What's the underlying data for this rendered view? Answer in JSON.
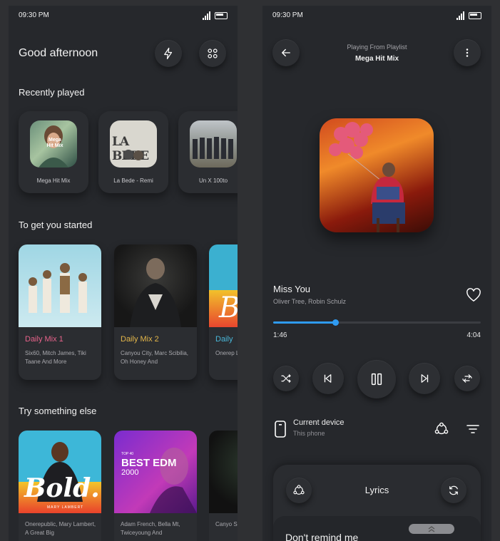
{
  "left": {
    "status": {
      "time": "09:30 PM",
      "network": "5G"
    },
    "greeting": "Good afternoon",
    "sections": {
      "recently_played": "Recently played",
      "to_get_started": "To get you started",
      "try_something": "Try something else"
    },
    "recent": [
      {
        "label": "Mega Hit Mix",
        "art_text": "Mega Hit Mix"
      },
      {
        "label": "La Bede - Remi",
        "art_text": "LA BEDE"
      },
      {
        "label": "Un X 100to"
      }
    ],
    "mixes": [
      {
        "name": "Daily Mix 1",
        "desc": "Six60, Mitch James, Tiki Taane And More",
        "color": "#e7638b"
      },
      {
        "name": "Daily Mix 2",
        "desc": "Canyou City, Marc Scibilia, Oh Honey And",
        "color": "#e3b64a"
      },
      {
        "name": "Daily",
        "desc": "Onerep Lambe",
        "color": "#49b7d9"
      }
    ],
    "try": [
      {
        "desc": "Onerepublic, Mary Lambert, A Great Big",
        "art_text": "Bold.",
        "art_sub": "MARY LAMBERT"
      },
      {
        "desc": "Adam French, Bella Mt, Twiceyoung And",
        "art_top": "TOP 40",
        "art_title": "BEST EDM",
        "art_year": "2000"
      },
      {
        "desc": "Canyo Scibilia"
      }
    ]
  },
  "right": {
    "status": {
      "time": "09:30 PM",
      "network": "5G"
    },
    "playing_from": "Playing From Playlist",
    "playlist": "Mega Hit Mix",
    "song": "Miss You",
    "artist": "Oliver Tree, Robin Schulz",
    "progress": 0.3,
    "time_current": "1:46",
    "time_total": "4:04",
    "device_title": "Current device",
    "device_sub": "This phone",
    "lyrics": "Lyrics",
    "remind": "Don't remind me",
    "accent": "#2f9bf2"
  }
}
